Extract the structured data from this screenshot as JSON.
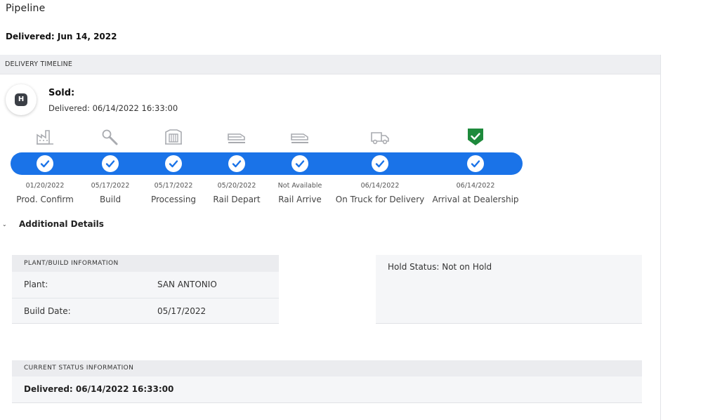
{
  "page": {
    "title": "Pipeline",
    "delivered_heading": "Delivered: Jun 14, 2022"
  },
  "timeline": {
    "header": "DELIVERY TIMELINE",
    "status": {
      "badge": "H",
      "label": "Sold:",
      "date_text": "Delivered: 06/14/2022 16:33:00"
    },
    "progress_color": "#1a73e8",
    "steps": [
      {
        "name": "Prod. Confirm",
        "date": "01/20/2022",
        "icon": "factory-icon",
        "completed": true
      },
      {
        "name": "Build",
        "date": "05/17/2022",
        "icon": "wrench-icon",
        "completed": true
      },
      {
        "name": "Processing",
        "date": "05/17/2022",
        "icon": "processing-station-icon",
        "completed": true
      },
      {
        "name": "Rail Depart",
        "date": "05/20/2022",
        "icon": "railcar-icon",
        "completed": true
      },
      {
        "name": "Rail Arrive",
        "date": "Not Available",
        "icon": "railcar-icon",
        "completed": true
      },
      {
        "name": "On Truck for Delivery",
        "date": "06/14/2022",
        "icon": "truck-icon",
        "completed": true
      },
      {
        "name": "Arrival at Dealership",
        "date": "06/14/2022",
        "icon": "green-shield-check-icon",
        "completed": true
      }
    ]
  },
  "additional_details": {
    "toggle_label": "Additional Details",
    "plant_build": {
      "header": "PLANT/BUILD INFORMATION",
      "rows": [
        {
          "label": "Plant:",
          "value": "SAN ANTONIO"
        },
        {
          "label": "Build Date:",
          "value": "05/17/2022"
        }
      ]
    },
    "hold_status": {
      "text": "Hold Status: Not on Hold"
    },
    "current_status": {
      "header": "CURRENT STATUS INFORMATION",
      "text": "Delivered: 06/14/2022 16:33:00"
    }
  },
  "colors": {
    "accent": "#1a73e8",
    "dealership_green": "#1e8a3c",
    "icon_gray": "#a9abb0"
  }
}
